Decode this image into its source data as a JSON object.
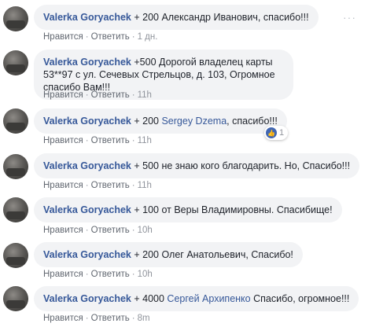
{
  "actions": {
    "like": "Нравится",
    "reply": "Ответить",
    "separator": "·"
  },
  "more_glyph": "···",
  "comments": [
    {
      "author": "Valerka Goryachek",
      "text_before": " + 200 Александр Иванович, спасибо!!!",
      "time": "1 дн."
    },
    {
      "author": "Valerka Goryachek",
      "text_before": " +500 Дорогой владелец карты 53**97 с ул. Сечевых Стрельцов, д. 103, Огромное спасибо Вам!!!",
      "time": "11h"
    },
    {
      "author": "Valerka Goryachek",
      "text_before": " + 200 ",
      "mention": "Sergey Dzema",
      "text_after": ", спасибо!!!",
      "time": "11h",
      "reactions": {
        "count": "1",
        "icon": "like-icon"
      }
    },
    {
      "author": "Valerka Goryachek",
      "text_before": " + 500 не знаю кого благодарить. Но, Спасибо!!!",
      "time": "11h"
    },
    {
      "author": "Valerka Goryachek",
      "text_before": " + 100 от Веры Владимировны. Спасибище!",
      "time": "10h"
    },
    {
      "author": "Valerka Goryachek",
      "text_before": " + 200 Олег Анатольевич, Спасибо!",
      "time": "10h"
    },
    {
      "author": "Valerka Goryachek",
      "text_before": " + 4000 ",
      "mention": "Сергей Архипенко",
      "text_after": " Спасибо, огромное!!!",
      "time": "8m"
    }
  ]
}
